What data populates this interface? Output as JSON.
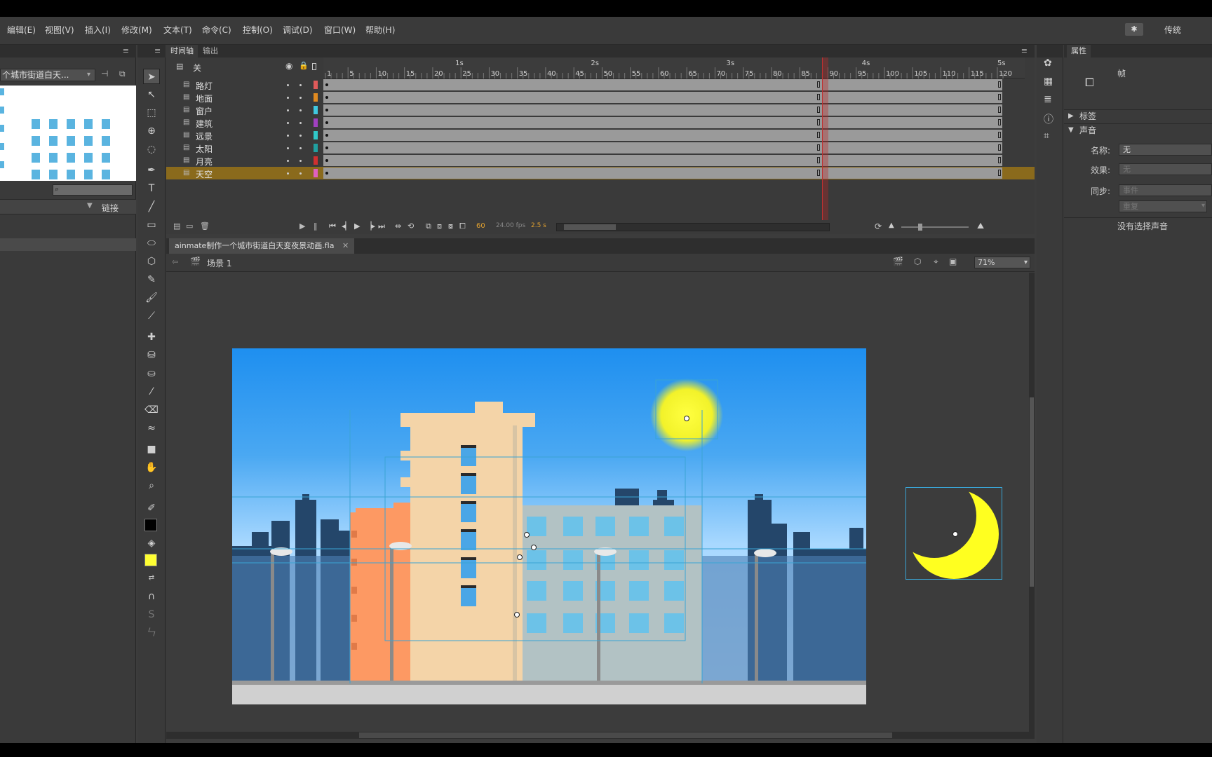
{
  "menu": [
    "编辑(E)",
    "视图(V)",
    "插入(I)",
    "修改(M)",
    "文本(T)",
    "命令(C)",
    "控制(O)",
    "调试(D)",
    "窗口(W)",
    "帮助(H)"
  ],
  "workspace": "传统",
  "gear_label": "✱",
  "library": {
    "doc_dropdown": "个城市街道白天...",
    "link_col": "链接"
  },
  "timeline": {
    "tabs": [
      "时间轴",
      "输出"
    ],
    "header_layer": "关",
    "seconds": [
      "1s",
      "2s",
      "3s",
      "4s",
      "5s"
    ],
    "frames": [
      "1",
      "5",
      "10",
      "15",
      "20",
      "25",
      "30",
      "35",
      "40",
      "45",
      "50",
      "55",
      "60",
      "65",
      "70",
      "75",
      "80",
      "85",
      "90",
      "95",
      "100",
      "105",
      "110",
      "115",
      "120"
    ],
    "layers": [
      {
        "name": "路灯",
        "color": "#e05a5a"
      },
      {
        "name": "地面",
        "color": "#e08a20"
      },
      {
        "name": "窗户",
        "color": "#40c8e0"
      },
      {
        "name": "建筑",
        "color": "#a040c0"
      },
      {
        "name": "远景",
        "color": "#30c8c8"
      },
      {
        "name": "太阳",
        "color": "#20a0a0"
      },
      {
        "name": "月亮",
        "color": "#d03030"
      },
      {
        "name": "天空",
        "color": "#e060c0"
      }
    ],
    "current_frame": "60",
    "fps": "24.00 fps",
    "time": "2.5 s"
  },
  "document": {
    "tab": "ainmate制作一个城市街道白天变夜景动画.fla",
    "scene": "场景 1",
    "zoom": "71%"
  },
  "properties": {
    "tab": "属性",
    "type": "帧",
    "sec_label": "标签",
    "sec_sound": "声音",
    "name_label": "名称:",
    "name_value": "无",
    "effect_label": "效果:",
    "effect_value": "无",
    "sync_label": "同步:",
    "sync_value": "事件",
    "repeat_value": "重复",
    "no_sound": "没有选择声音"
  }
}
